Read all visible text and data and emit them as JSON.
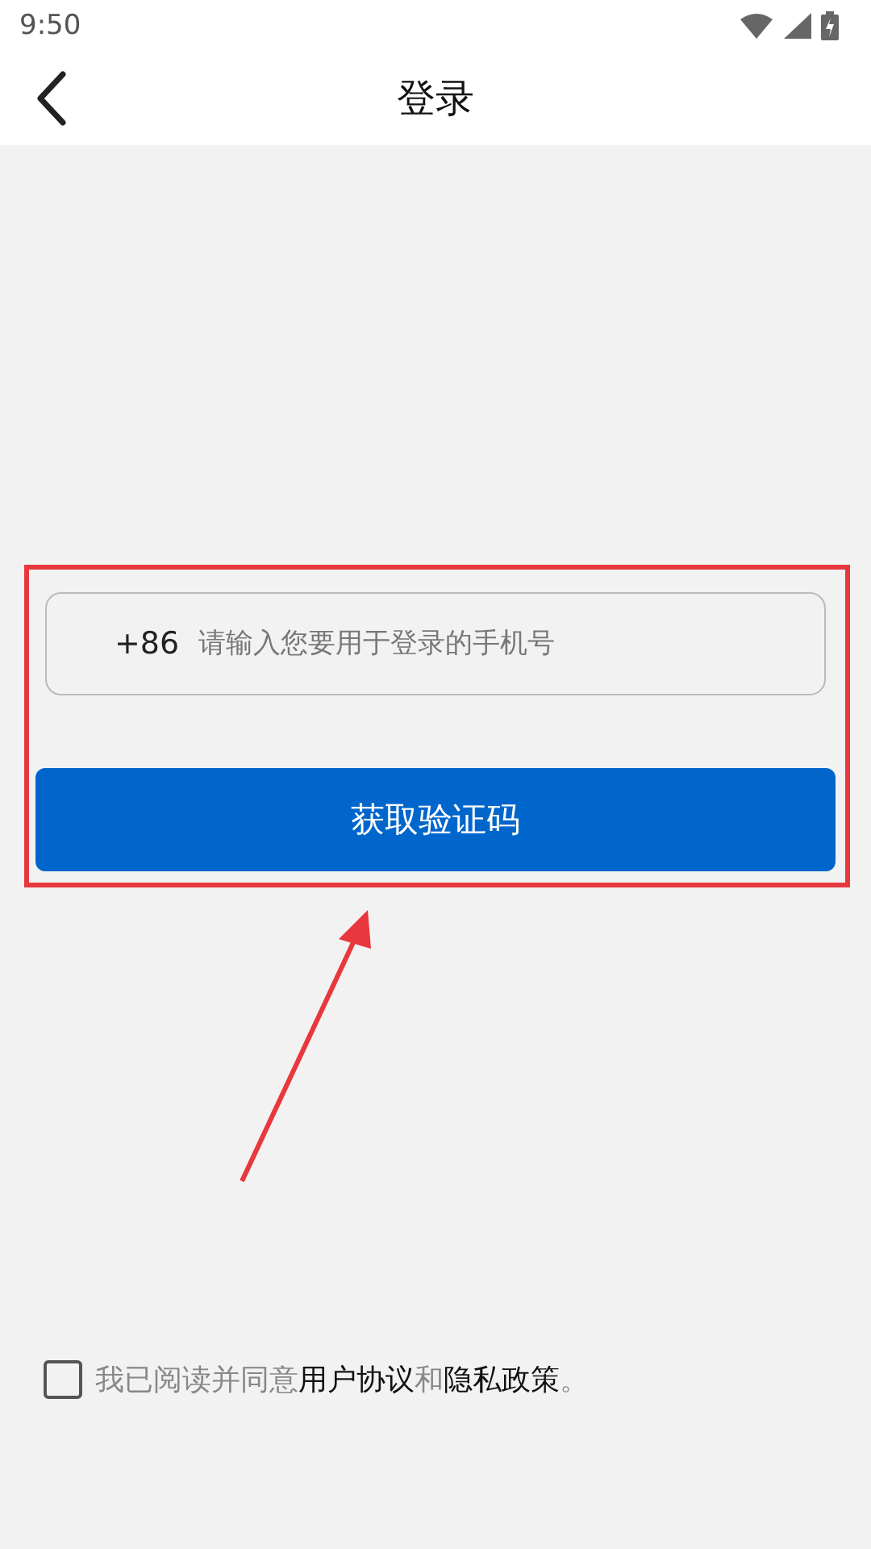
{
  "status_bar": {
    "time": "9:50"
  },
  "header": {
    "title": "登录"
  },
  "phone_field": {
    "prefix": "+86",
    "placeholder": "请输入您要用于登录的手机号"
  },
  "submit_button": {
    "label": "获取验证码"
  },
  "agreement": {
    "checked": false,
    "parts": [
      {
        "kind": "text",
        "text": "我已阅读并同意"
      },
      {
        "kind": "link",
        "text": "用户协议"
      },
      {
        "kind": "text",
        "text": "和"
      },
      {
        "kind": "link",
        "text": "隐私政策"
      },
      {
        "kind": "text",
        "text": "。"
      }
    ]
  }
}
